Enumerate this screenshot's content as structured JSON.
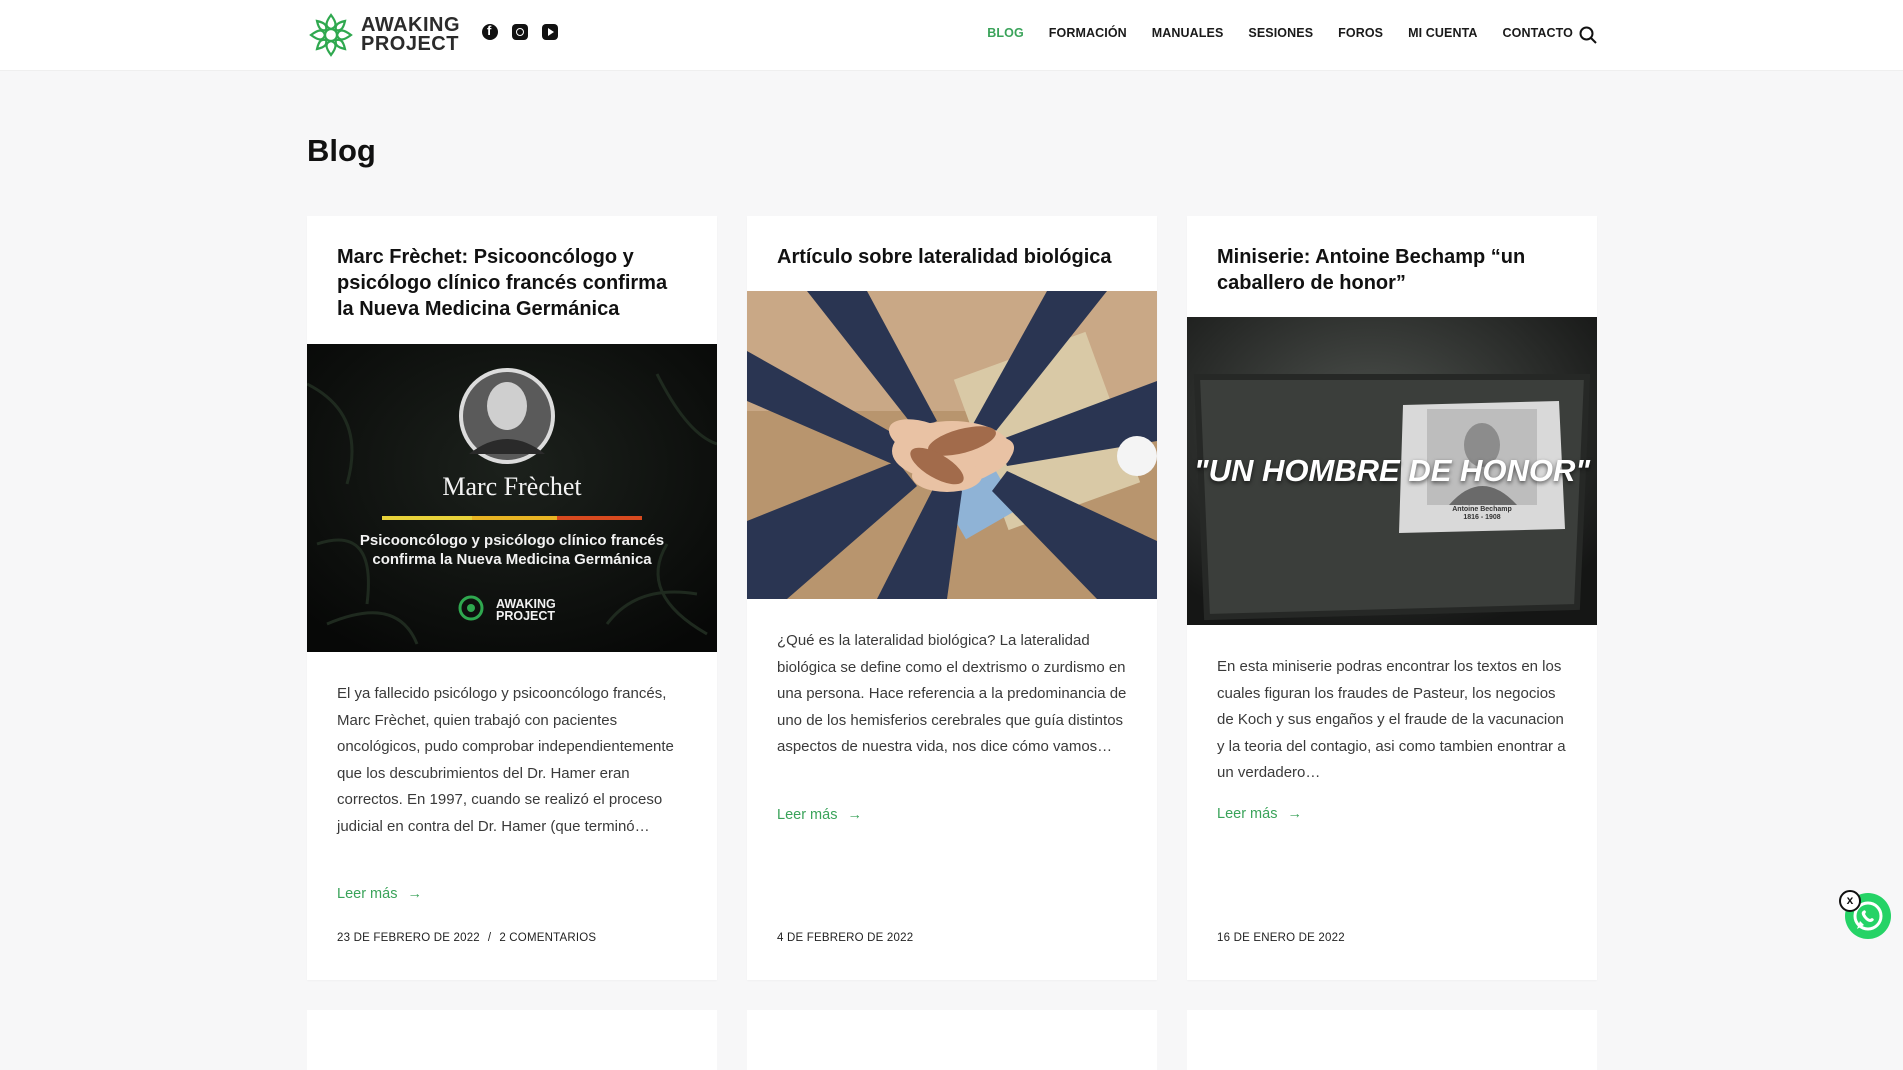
{
  "header": {
    "logo_line1": "AWAKING",
    "logo_line2": "PROJECT",
    "socials": [
      "facebook-icon",
      "instagram-icon",
      "youtube-icon"
    ],
    "nav": [
      "BLOG",
      "FORMACIÓN",
      "MANUALES",
      "SESIONES",
      "FOROS",
      "MI CUENTA",
      "CONTACTO"
    ],
    "active_nav": "BLOG",
    "accent": "#3aa35a"
  },
  "page": {
    "title": "Blog"
  },
  "posts": [
    {
      "title": "Marc Frèchet: Psicooncólogo y psicólogo clínico francés confirma la Nueva Medicina Germánica",
      "image": {
        "name": "Marc Frèchet",
        "line1": "Psicooncólogo y psicólogo clínico francés",
        "line2": "confirma la Nueva Medicina Germánica",
        "logo_line1": "AWAKING",
        "logo_line2": "PROJECT"
      },
      "excerpt": "El ya fallecido psicólogo y psicooncólogo francés, Marc Frèchet, quien trabajó con pacientes oncológicos, pudo comprobar independientemente que los descubrimientos del Dr. Hamer eran correctos. En 1997, cuando se realizó el proceso judicial en contra del Dr. Hamer (que terminó…",
      "read_more": "Leer más",
      "date": "23 DE FEBRERO DE 2022",
      "separator": "/",
      "comments": "2 COMENTARIOS"
    },
    {
      "title": "Artículo sobre lateralidad biológica",
      "excerpt": "¿Qué es la lateralidad biológica? La lateralidad biológica se define como el dextrismo o zurdismo en una persona. Hace referencia a  la predominancia de uno de los hemisferios cerebrales que guía distintos aspectos de nuestra vida, nos dice cómo vamos…",
      "read_more": "Leer más",
      "date": "4 DE FEBRERO DE 2022"
    },
    {
      "title": "Miniserie: Antoine Bechamp “un caballero de honor”",
      "image": {
        "caption": "\"UN HOMBRE DE HONOR\"",
        "photo_caption_1": "Antoine Bechamp",
        "photo_caption_2": "1816 - 1908"
      },
      "excerpt": "En esta miniserie podras encontrar los textos en los cuales figuran los fraudes de Pasteur, los negocios de Koch y sus engaños y el fraude de la vacunacion y la teoria del contagio, asi como tambien enontrar a un verdadero…",
      "read_more": "Leer más",
      "date": "16 DE ENERO DE 2022"
    }
  ],
  "whatsapp": {
    "close_label": "x"
  }
}
